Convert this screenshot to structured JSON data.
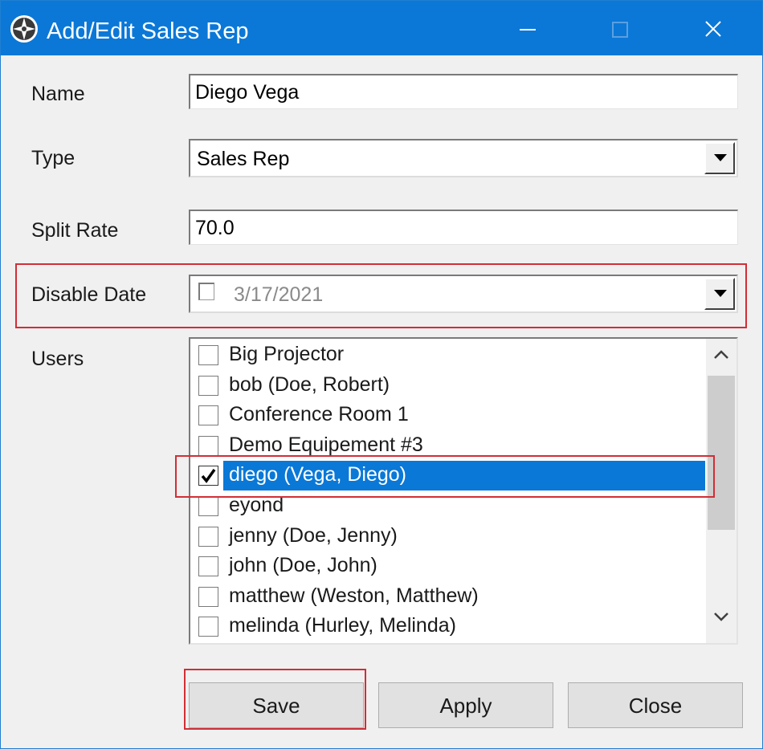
{
  "window": {
    "title": "Add/Edit Sales Rep"
  },
  "titlebar": {
    "icons": [
      "app-compass-icon",
      "minimize-icon",
      "maximize-icon",
      "close-icon"
    ]
  },
  "form": {
    "name_label": "Name",
    "name_value": "Diego Vega",
    "type_label": "Type",
    "type_value": "Sales Rep",
    "split_rate_label": "Split Rate",
    "split_rate_value": "70.0",
    "disable_date_label": "Disable Date",
    "disable_date_checked": false,
    "disable_date_value": "3/17/2021",
    "users_label": "Users"
  },
  "users": [
    {
      "label": "Big Projector",
      "checked": false,
      "selected": false
    },
    {
      "label": "bob (Doe, Robert)",
      "checked": false,
      "selected": false
    },
    {
      "label": "Conference Room 1",
      "checked": false,
      "selected": false
    },
    {
      "label": "Demo Equipement #3",
      "checked": false,
      "selected": false
    },
    {
      "label": "diego  (Vega, Diego)",
      "checked": true,
      "selected": true
    },
    {
      "label": "eyond",
      "checked": false,
      "selected": false
    },
    {
      "label": "jenny (Doe, Jenny)",
      "checked": false,
      "selected": false
    },
    {
      "label": "john (Doe, John)",
      "checked": false,
      "selected": false
    },
    {
      "label": "matthew (Weston, Matthew)",
      "checked": false,
      "selected": false
    },
    {
      "label": "melinda (Hurley, Melinda)",
      "checked": false,
      "selected": false
    }
  ],
  "buttons": {
    "save": "Save",
    "apply": "Apply",
    "close": "Close"
  },
  "colors": {
    "titlebar": "#0b78d7",
    "selection": "#0a78d7",
    "highlight_box": "#d12e36"
  }
}
